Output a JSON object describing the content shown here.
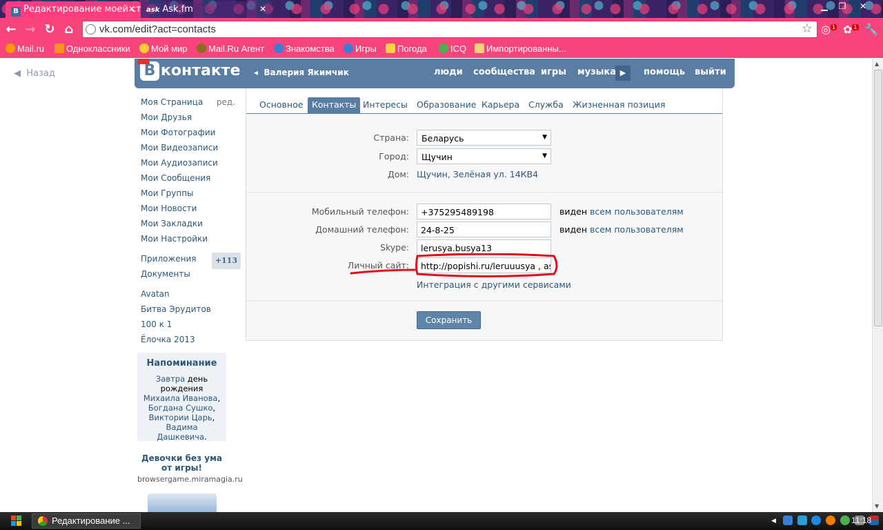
{
  "browser": {
    "tabs": [
      {
        "label": "Редактирование моей ст",
        "favicon": "В"
      },
      {
        "label": "Ask.fm",
        "favicon": "ask"
      }
    ],
    "url": "vk.com/edit?act=contacts",
    "bookmarks": [
      "Mail.ru",
      "Одноклассники",
      "Мой мир",
      "Mail.Ru Агент",
      "Знакомства",
      "Игры",
      "Погода",
      "ICQ",
      "Импортированны..."
    ],
    "extension_badges": [
      "1",
      "1"
    ],
    "accent_color": "#f7457c"
  },
  "page": {
    "back_label": "Назад",
    "header": {
      "logo": "контакте",
      "logo_letter": "В",
      "user": "Валерия Якимчик",
      "nav": [
        "люди",
        "сообщества",
        "игры",
        "музыка",
        "помощь",
        "выйти"
      ]
    },
    "menu": {
      "my_page": "Моя Страница",
      "edit": "ред.",
      "items": [
        "Мои Друзья",
        "Мои Фотографии",
        "Мои Видеозаписи",
        "Мои Аудиозаписи",
        "Мои Сообщения",
        "Мои Группы",
        "Мои Новости",
        "Мои Закладки",
        "Мои Настройки"
      ],
      "apps": "Приложения",
      "apps_count": "+113",
      "docs": "Документы",
      "games": [
        "Avatan",
        "Битва Эрудитов",
        "100 к 1",
        "Ёлочка 2013"
      ]
    },
    "reminder": {
      "title": "Напоминание",
      "when": "Завтра",
      "text1": " день рождения ",
      "name1": "Михаила Иванова",
      "name2": "Богдана Сушко",
      "name3": "Виктории Царь",
      "name4": "Вадима Дашкевича"
    },
    "ad": {
      "title": "Девочки без ума от игры!",
      "domain": "browsergame.miramagia.ru"
    },
    "tabs": [
      "Основное",
      "Контакты",
      "Интересы",
      "Образование",
      "Карьера",
      "Служба",
      "Жизненная позиция"
    ],
    "form": {
      "country_label": "Страна:",
      "country": "Беларусь",
      "city_label": "Город:",
      "city": "Щучин",
      "home_label": "Дом:",
      "home": "Щучин, Зелёная ул. 14КВ4",
      "mobile_label": "Мобильный телефон:",
      "mobile": "+375295489198",
      "homephone_label": "Домашний телефон:",
      "homephone": "24-8-25",
      "visible_prefix": "виден ",
      "visible_link": "всем пользователям",
      "skype_label": "Skype:",
      "skype": "lerusya.busya13",
      "site_label": "Личный сайт:",
      "site": "http://popishi.ru/leruuusya , ask.fm",
      "integration": "Интеграция с другими сервисами",
      "save": "Сохранить"
    },
    "annotation_color": "#e0101a"
  },
  "taskbar": {
    "task": "Редактирование ...",
    "clock": "11:18"
  }
}
